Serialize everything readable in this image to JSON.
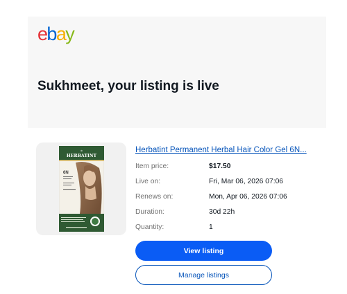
{
  "header": {
    "logo_text": "ebay",
    "logo_letters": [
      "e",
      "b",
      "a",
      "y"
    ],
    "logo_colors": [
      "#e53238",
      "#0064d2",
      "#f5af02",
      "#86b817"
    ],
    "headline": "Sukhmeet, your listing is live"
  },
  "listing": {
    "image_icon": "product-image",
    "image_brand": "HERBATINT",
    "image_shade": "6N",
    "title": "Herbatint Permanent Herbal Hair Color Gel 6N...",
    "details": [
      {
        "label": "Item price:",
        "value": "$17.50"
      },
      {
        "label": "Live on:",
        "value": "Fri, Mar 06, 2026 07:06"
      },
      {
        "label": "Renews on:",
        "value": "Mon, Apr 06, 2026 07:06"
      },
      {
        "label": "Duration:",
        "value": "30d 22h"
      },
      {
        "label": "Quantity:",
        "value": "1"
      }
    ]
  },
  "actions": {
    "view_label": "View listing",
    "manage_label": "Manage listings"
  },
  "colors": {
    "hero_bg": "#f7f7f7",
    "link": "#0654ba",
    "primary_button": "#0a5cf5"
  }
}
